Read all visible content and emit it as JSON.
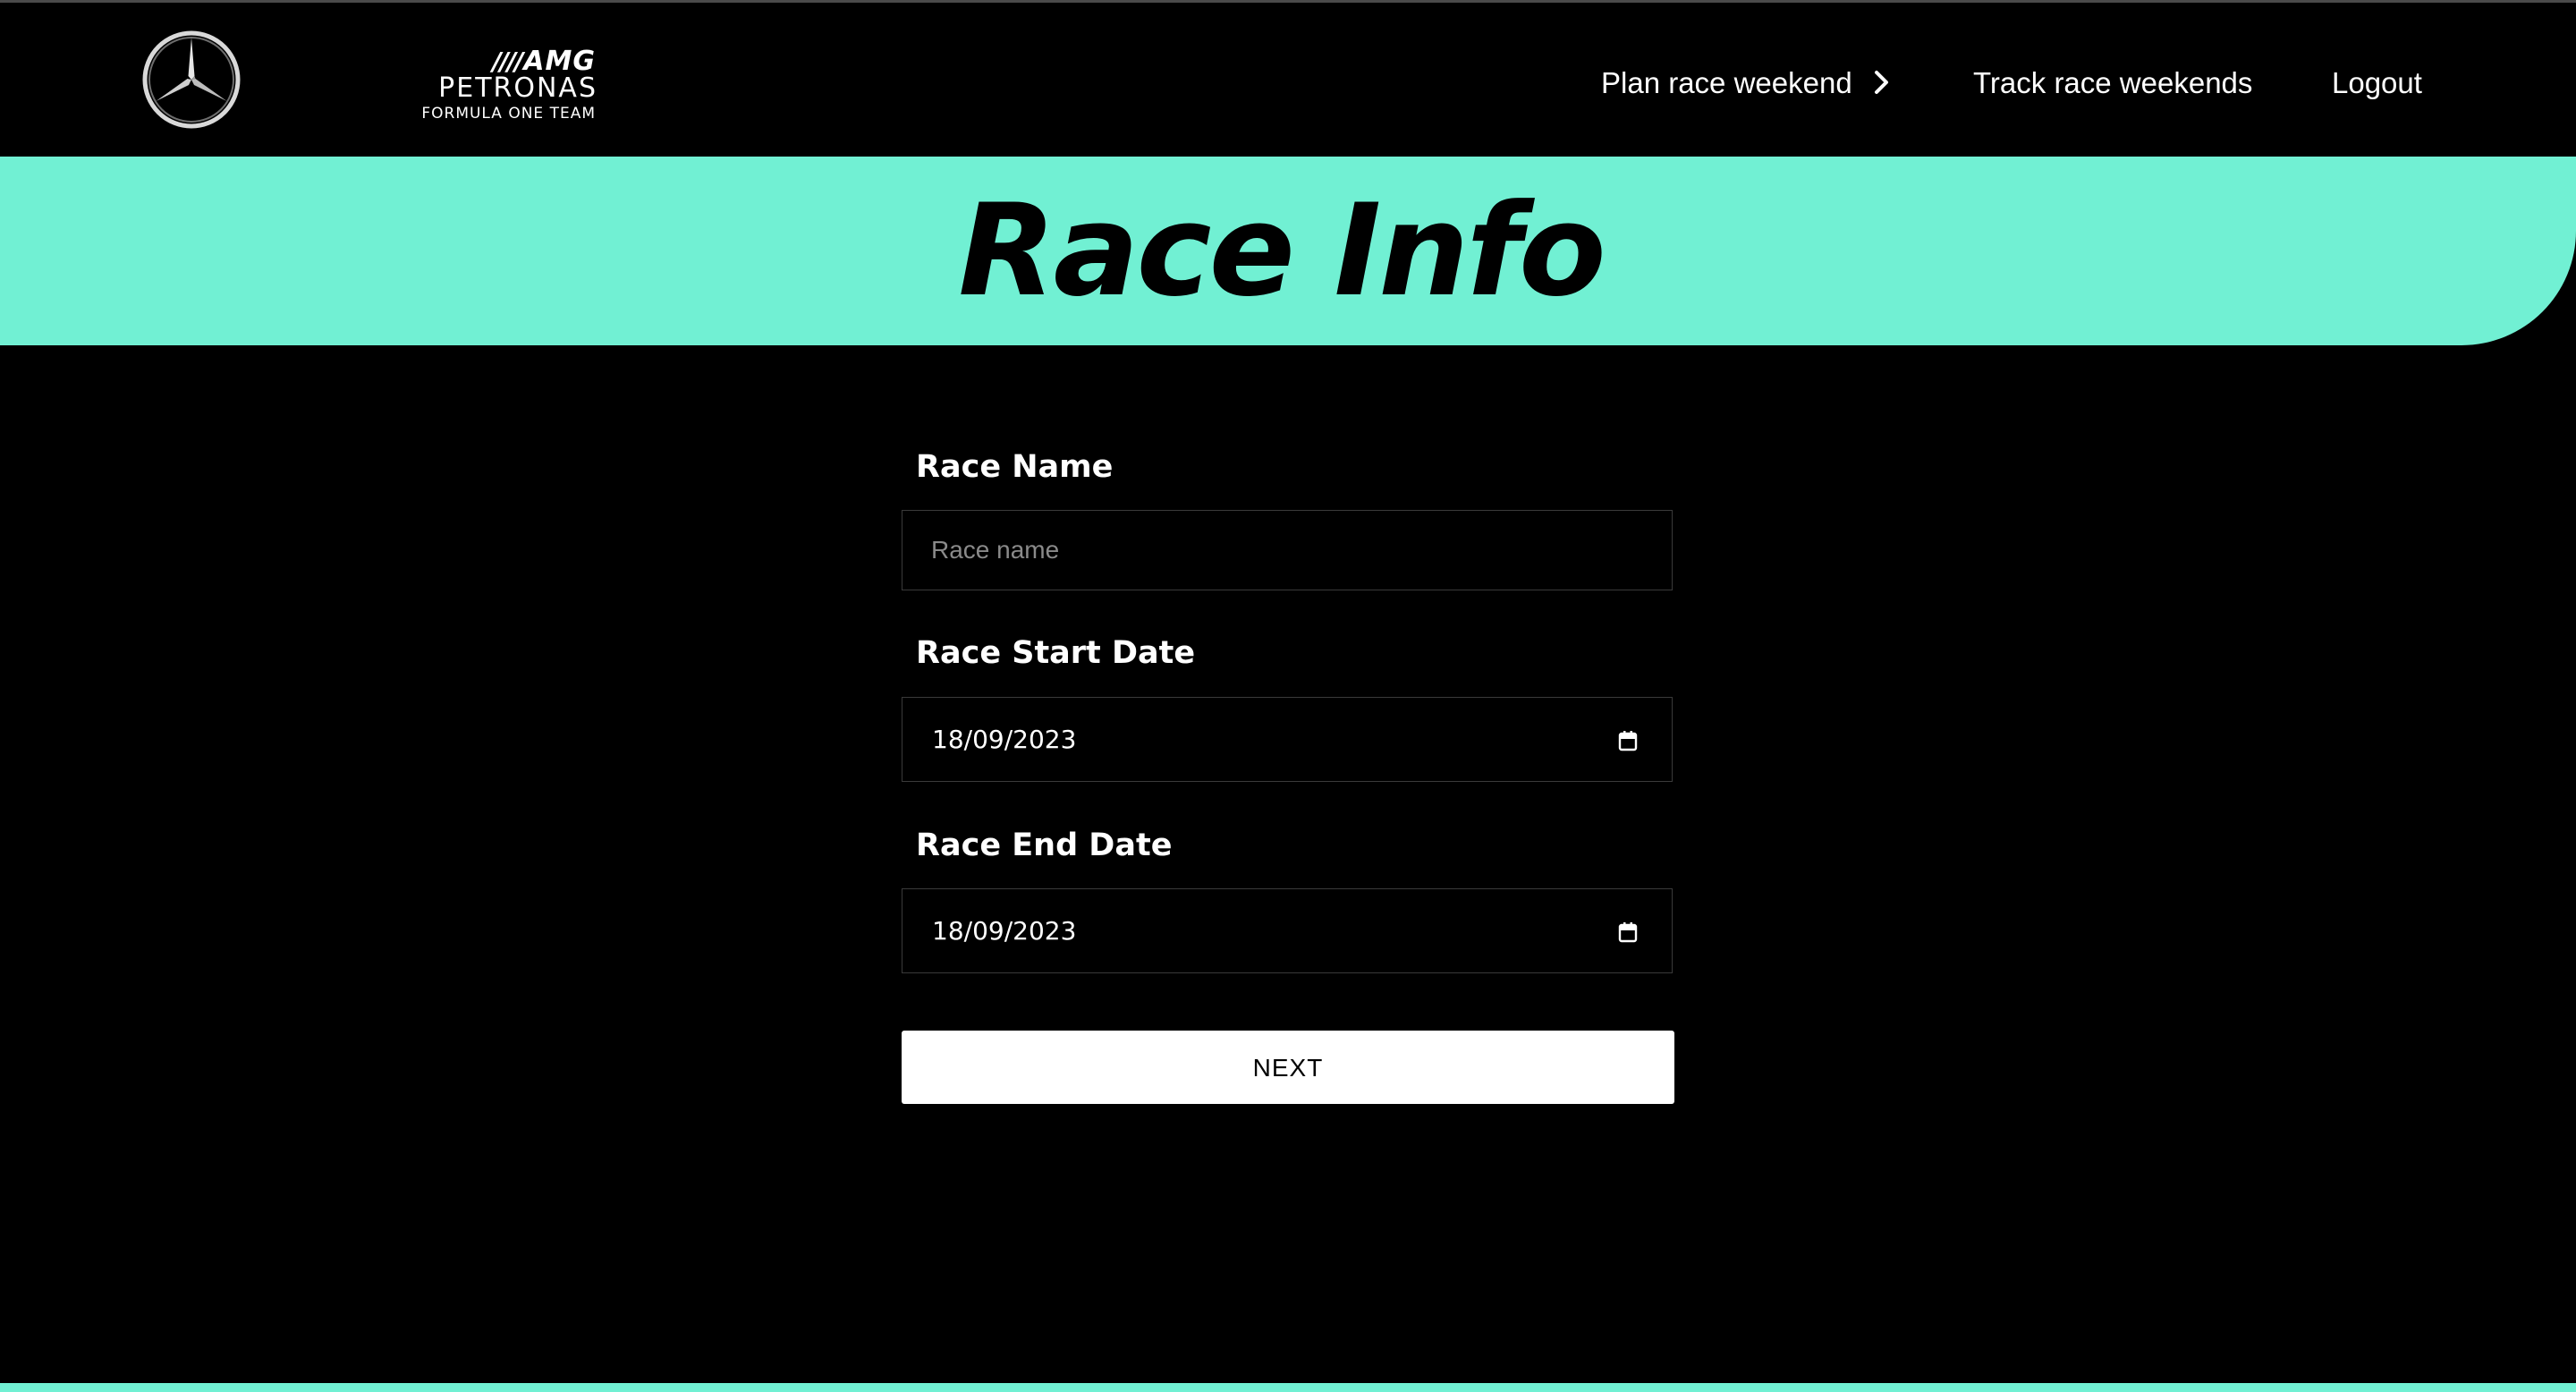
{
  "brand": {
    "slashes": "////",
    "amg": "AMG",
    "petronas": "PETRONAS",
    "subtitle": "FORMULA ONE TEAM",
    "logo_icon": "mercedes-star-icon"
  },
  "nav": {
    "plan_label": "Plan race weekend",
    "plan_icon": "chevron-right-icon",
    "track_label": "Track race weekends",
    "logout_label": "Logout"
  },
  "banner": {
    "title": "Race Info"
  },
  "form": {
    "race_name": {
      "label": "Race Name",
      "placeholder": "Race name",
      "value": ""
    },
    "start_date": {
      "label": "Race Start Date",
      "value": "18/09/2023",
      "icon": "calendar-icon"
    },
    "end_date": {
      "label": "Race End Date",
      "value": "18/09/2023",
      "icon": "calendar-icon"
    },
    "next_label": "NEXT"
  },
  "colors": {
    "accent": "#71f0d3",
    "background": "#000000",
    "text": "#ffffff",
    "field_border": "#3a3a3a",
    "placeholder": "#8a8a8a"
  }
}
